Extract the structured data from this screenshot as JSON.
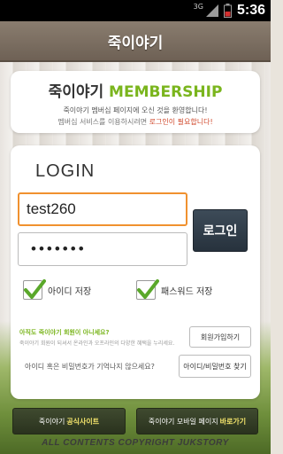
{
  "status_bar": {
    "network": "3G",
    "time": "5:36"
  },
  "header": {
    "title": "죽이야기"
  },
  "membership": {
    "title_prefix": "죽이야기",
    "title_suffix": "MEMBERSHIP",
    "welcome": "죽이야기 멤버십 페이지에 오신 것을 환영합니다!",
    "notice_prefix": "멤버십 서비스를 이용하시려면",
    "notice_highlight": "로그인이 필요합니다!",
    "accent_color": "#7ab51d"
  },
  "login": {
    "label": "LOGIN",
    "id_value": "test260",
    "password_value": "•••••••",
    "button_label": "로그인",
    "save_id_label": "아이디 저장",
    "save_password_label": "패스워드 저장",
    "save_id_checked": true,
    "save_password_checked": true
  },
  "join": {
    "question": "아직도 죽이야기 회원이 아니세요?",
    "description": "죽이야기 회원이 되셔서 온라인과 오프라인의 다양한 혜택을 누리세요.",
    "button_label": "회원가입하기"
  },
  "find": {
    "question": "아이디 혹은 비밀번호가 기억나지 않으세요?",
    "button_label": "아이디/비밀번호 찾기"
  },
  "bottom": {
    "official_prefix": "죽이야기",
    "official_highlight": "공식사이트",
    "mobile_prefix": "죽이야기 모바일 페이지",
    "mobile_highlight": "바로가기",
    "copyright": "ALL CONTENTS COPYRIGHT JUKSTORY"
  }
}
